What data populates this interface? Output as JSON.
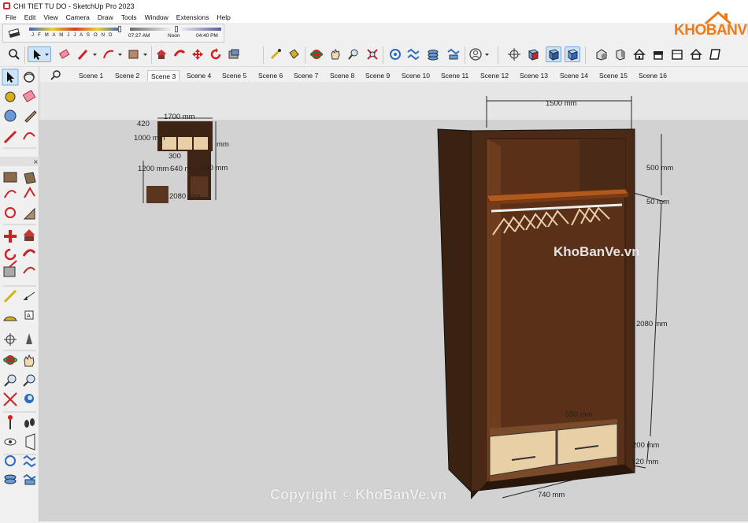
{
  "window": {
    "title": "CHI TIET TU DO - SketchUp Pro 2023"
  },
  "menu": [
    "File",
    "Edit",
    "View",
    "Camera",
    "Draw",
    "Tools",
    "Window",
    "Extensions",
    "Help"
  ],
  "shadows": {
    "months": "J F M A M J J A S O N D",
    "time_start": "07:27 AM",
    "time_mid": "Noon",
    "time_end": "04:40 PM"
  },
  "scenes": [
    "Scene 1",
    "Scene 2",
    "Scene 3",
    "Scene 4",
    "Scene 5",
    "Scene 6",
    "Scene 7",
    "Scene 8",
    "Scene 9",
    "Scene 10",
    "Scene 11",
    "Scene 12",
    "Scene 13",
    "Scene 14",
    "Scene 15",
    "Scene 16"
  ],
  "active_scene": "Scene 3",
  "logo": {
    "text": "KHOBANVE"
  },
  "watermark": {
    "center": "KhoBanVe.vn",
    "bottom": "Copyright © KhoBanVe.vn"
  },
  "dimensions": {
    "width_top": "1500 mm",
    "shelf_top": "500 mm",
    "shelf_thick": "50 mm",
    "hang_height": "2080 mm",
    "drawer_height": "200 mm",
    "plinth": "120 mm",
    "depth_inner": "550 mm",
    "drawer_width": "740 mm"
  },
  "small_model_labels": {
    "a": "1700 mm",
    "b": "1000 mm",
    "c": "1200 mm",
    "d": "300",
    "e": "640 m",
    "f": "200 mm",
    "g": "420",
    "h": "mm",
    "i": "2080 mm"
  },
  "colors": {
    "wood_dark": "#3e2414",
    "wood_mid": "#5a3520",
    "shelf_orange": "#b25a1e",
    "drawer_face": "#e8cfa6",
    "accent": "#f07b16"
  }
}
